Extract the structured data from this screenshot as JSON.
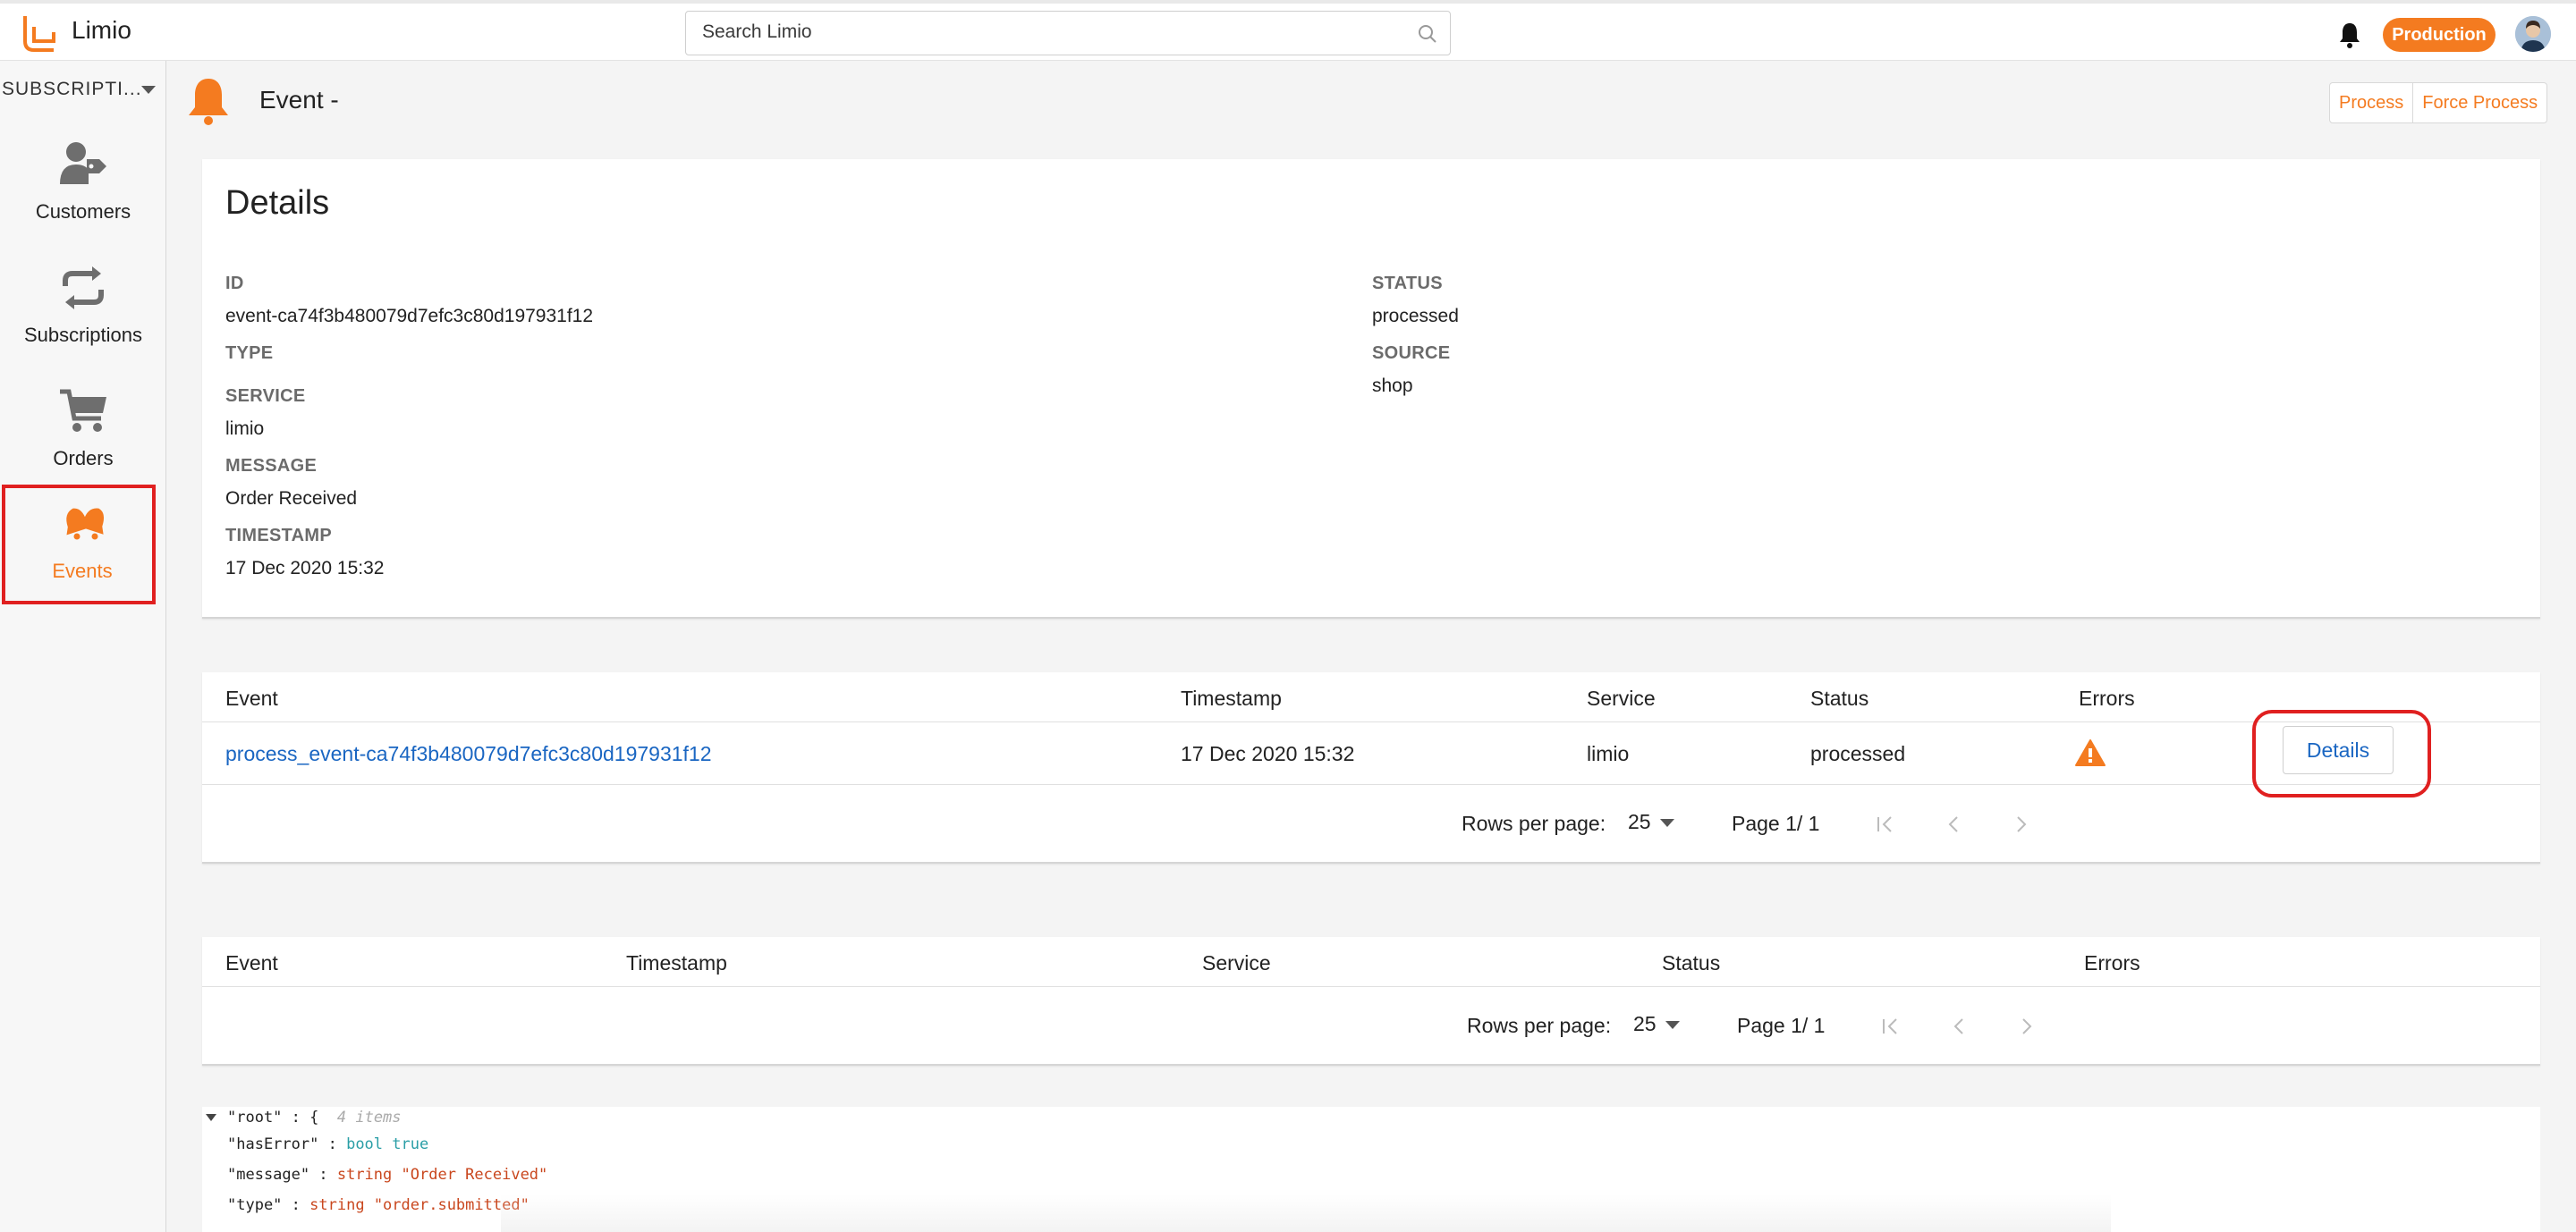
{
  "app": {
    "name": "Limio",
    "brand_color": "#f47b20"
  },
  "search": {
    "placeholder": "Search Limio"
  },
  "topbar": {
    "environment": "Production"
  },
  "sidebar": {
    "section": "SUBSCRIPTI...",
    "items": [
      {
        "label": "Customers",
        "icon": "customer-tag-icon"
      },
      {
        "label": "Subscriptions",
        "icon": "repeat-icon"
      },
      {
        "label": "Orders",
        "icon": "cart-icon"
      },
      {
        "label": "Events",
        "icon": "bells-icon",
        "active": true
      }
    ]
  },
  "header": {
    "title": "Event -",
    "buttons": {
      "process": "Process",
      "force_process": "Force Process"
    }
  },
  "details": {
    "title": "Details",
    "id_label": "ID",
    "id_value": "event-ca74f3b480079d7efc3c80d197931f12",
    "type_label": "TYPE",
    "service_label": "SERVICE",
    "service_value": "limio",
    "message_label": "MESSAGE",
    "message_value": "Order Received",
    "timestamp_label": "TIMESTAMP",
    "timestamp_value": "17 Dec 2020 15:32",
    "status_label": "STATUS",
    "status_value": "processed",
    "source_label": "SOURCE",
    "source_value": "shop"
  },
  "table1": {
    "headers": {
      "event": "Event",
      "timestamp": "Timestamp",
      "service": "Service",
      "status": "Status",
      "errors": "Errors"
    },
    "rows": [
      {
        "event": "process_event-ca74f3b480079d7efc3c80d197931f12",
        "timestamp": "17 Dec 2020 15:32",
        "service": "limio",
        "status": "processed",
        "errors_icon": "warning-icon",
        "action": "Details"
      }
    ],
    "pager": {
      "rows_per_page_label": "Rows per page:",
      "rows_per_page": "25",
      "page": "Page 1/ 1"
    }
  },
  "table2": {
    "headers": {
      "event": "Event",
      "timestamp": "Timestamp",
      "service": "Service",
      "status": "Status",
      "errors": "Errors"
    },
    "pager": {
      "rows_per_page_label": "Rows per page:",
      "rows_per_page": "25",
      "page": "Page 1/ 1"
    }
  },
  "json_view": {
    "root_key": "\"root\"",
    "root_open": ": {",
    "root_count": "4 items",
    "lines": [
      {
        "key": "\"hasError\"",
        "sep": " : ",
        "type": "bool",
        "value": "true"
      },
      {
        "key": "\"message\"",
        "sep": " : ",
        "type": "string",
        "value": "\"Order Received\""
      },
      {
        "key": "\"type\"",
        "sep": " : ",
        "type": "string",
        "value": "\"order.submitted\""
      }
    ]
  }
}
